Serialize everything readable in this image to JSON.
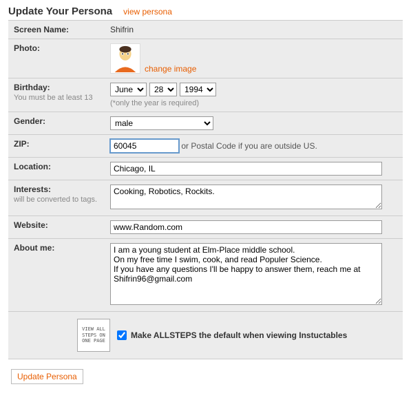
{
  "header": {
    "title": "Update Your Persona",
    "view_link": "view persona"
  },
  "screen_name": {
    "label": "Screen Name:",
    "value": "Shifrin"
  },
  "photo": {
    "label": "Photo:",
    "change_link": "change image"
  },
  "birthday": {
    "label": "Birthday:",
    "sublabel": "You must be at least 13",
    "month": "June",
    "day": "28",
    "year": "1994",
    "note": "(*only the year is required)"
  },
  "gender": {
    "label": "Gender:",
    "value": "male"
  },
  "zip": {
    "label": "ZIP:",
    "value": "60045",
    "hint": "or Postal Code if you are outside US."
  },
  "location": {
    "label": "Location:",
    "value": "Chicago, IL"
  },
  "interests": {
    "label": "Interests:",
    "sublabel": "will be converted to tags.",
    "value": "Cooking, Robotics, Rockits."
  },
  "website": {
    "label": "Website:",
    "value": "www.Random.com"
  },
  "about": {
    "label": "About me:",
    "value": "I am a young student at Elm-Place middle school.\nOn my free time I swim, cook, and read Populer Science.\nIf you have any questions I'll be happy to answer them, reach me at Shifrin96@gmail.com"
  },
  "allsteps": {
    "badge": "VIEW ALL\nSTEPS ON\nONE PAGE",
    "label": "Make ALLSTEPS the default when viewing Instuctables"
  },
  "submit": {
    "label": "Update Persona"
  }
}
